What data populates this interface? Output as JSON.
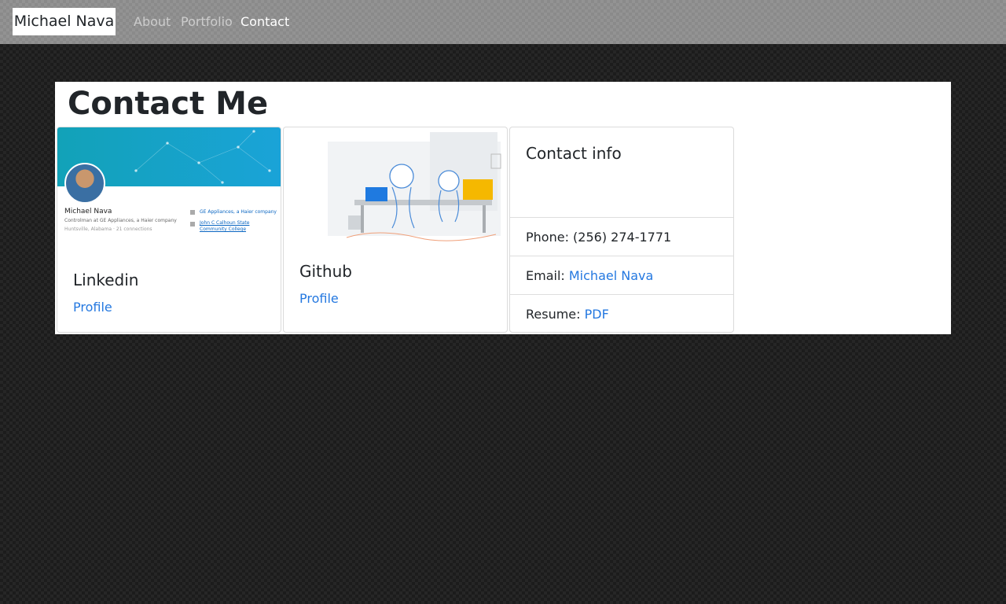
{
  "nav": {
    "brand": "Michael Nava",
    "links": [
      {
        "label": "About"
      },
      {
        "label": "Portfolio"
      },
      {
        "label": "Contact"
      }
    ]
  },
  "page": {
    "title": "Contact Me"
  },
  "linkedin_card": {
    "title": "Linkedin",
    "link": "Profile",
    "screenshot": {
      "name": "Michael Nava",
      "headline": "Controlman at GE Appliances, a Haier company",
      "location": "Huntsville, Alabama · 21 connections",
      "company": "GE Appliances, a Haier company",
      "school": "John C Calhoun State Community College"
    }
  },
  "github_card": {
    "title": "Github",
    "link": "Profile"
  },
  "contact_card": {
    "title": "Contact info",
    "phone_label": "Phone:",
    "phone_value": "(256) 274-1771",
    "email_label": "Email:",
    "email_value": "Michael Nava",
    "resume_label": "Resume:",
    "resume_value": "PDF"
  },
  "colors": {
    "link": "#2478e0",
    "navbar": "#8a8a8a",
    "background": "#1c1c1c"
  }
}
